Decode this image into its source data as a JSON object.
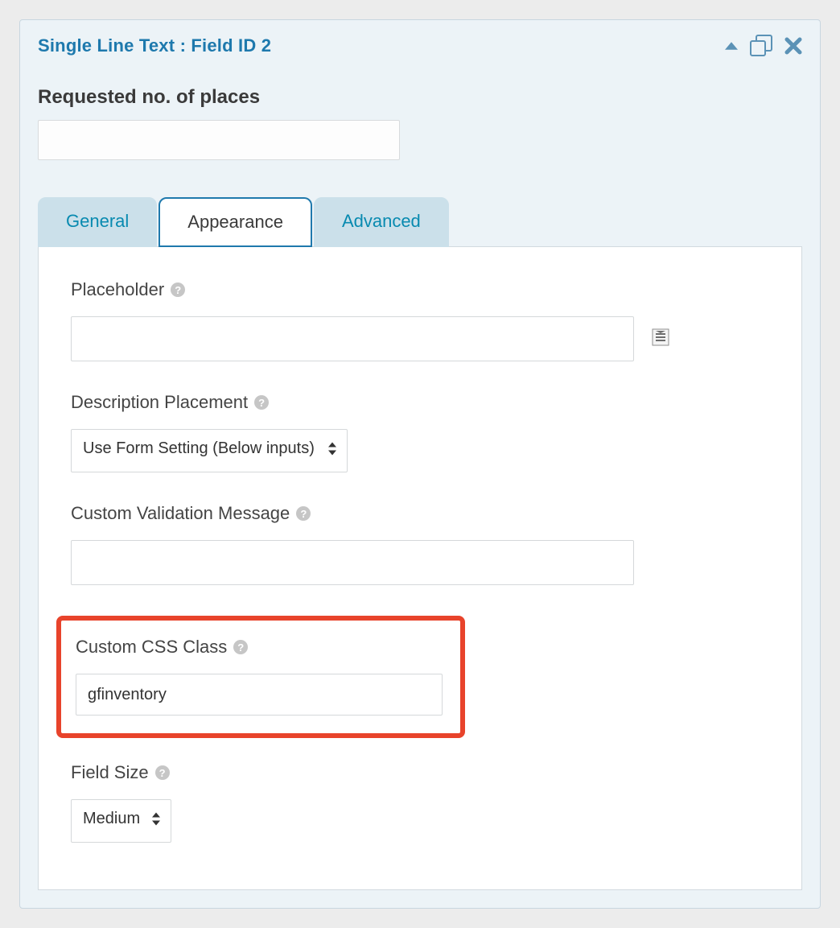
{
  "header": {
    "title": "Single Line Text : Field ID 2"
  },
  "preview": {
    "label": "Requested no. of places",
    "value": ""
  },
  "tabs": {
    "general": "General",
    "appearance": "Appearance",
    "advanced": "Advanced"
  },
  "settings": {
    "placeholder": {
      "label": "Placeholder",
      "value": ""
    },
    "descriptionPlacement": {
      "label": "Description Placement",
      "value": "Use Form Setting (Below inputs)"
    },
    "customValidation": {
      "label": "Custom Validation Message",
      "value": ""
    },
    "customCss": {
      "label": "Custom CSS Class",
      "value": "gfinventory"
    },
    "fieldSize": {
      "label": "Field Size",
      "value": "Medium"
    }
  }
}
